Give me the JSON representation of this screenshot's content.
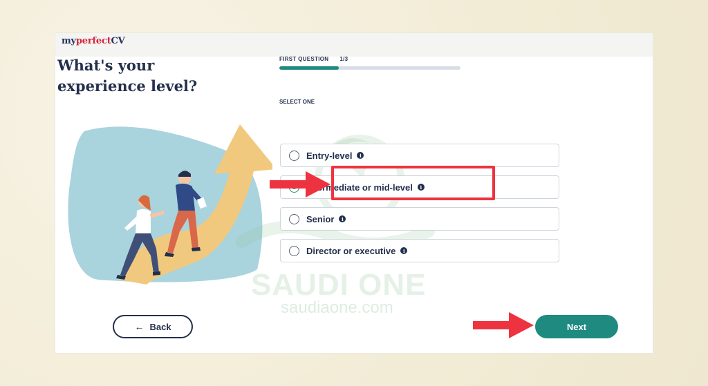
{
  "brand": {
    "part1": "my",
    "part2": "perfect",
    "part3": "CV"
  },
  "question": {
    "title": "What's your experience level?"
  },
  "progress": {
    "label": "FIRST QUESTION",
    "count": "1/3",
    "fraction": 0.33
  },
  "select_label": "SELECT ONE",
  "options": [
    {
      "label": "Entry-level",
      "selected": false
    },
    {
      "label": "Intermediate or mid-level",
      "selected": true
    },
    {
      "label": "Senior",
      "selected": false
    },
    {
      "label": "Director or executive",
      "selected": false
    }
  ],
  "info_glyph": "i",
  "buttons": {
    "back": "Back",
    "back_icon": "←",
    "next": "Next"
  },
  "watermark": {
    "text": "SAUDI ONE",
    "url": "saudiaone.com"
  },
  "colors": {
    "accent": "#1f8a80",
    "highlight": "#ee3340",
    "navy": "#23304c"
  }
}
